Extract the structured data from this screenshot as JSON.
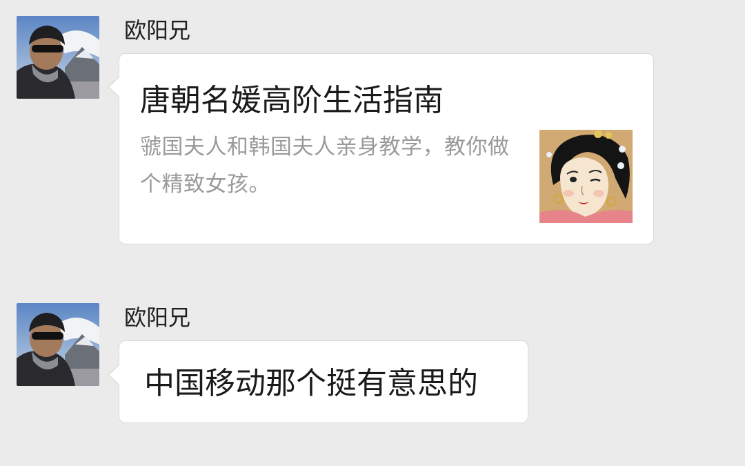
{
  "messages": [
    {
      "sender": "欧阳兄",
      "type": "link-card",
      "card": {
        "title": "唐朝名媛高阶生活指南",
        "description": "虢国夫人和韩国夫人亲身教学，教你做个精致女孩。",
        "thumbnail": "tang-lady-illustration"
      }
    },
    {
      "sender": "欧阳兄",
      "type": "text",
      "text": "中国移动那个挺有意思的"
    }
  ],
  "colors": {
    "background": "#ebebeb",
    "bubble": "#ffffff",
    "bubble_border": "#d9d9d9",
    "title": "#1a1a1a",
    "description": "#9a9a9a"
  }
}
